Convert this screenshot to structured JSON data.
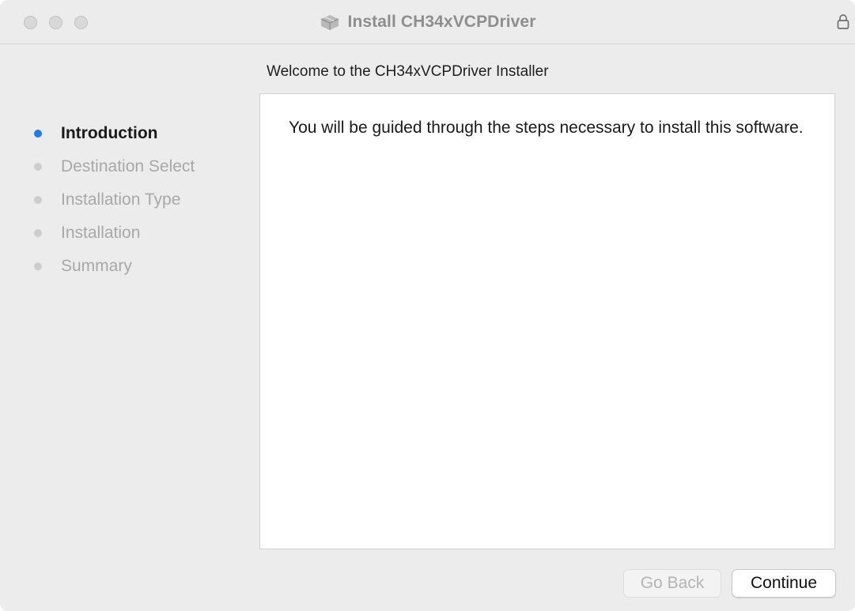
{
  "window": {
    "title": "Install CH34xVCPDriver",
    "title_icon": "package-installer-icon",
    "lock_icon": "lock-icon"
  },
  "header": {
    "welcome": "Welcome to the CH34xVCPDriver Installer"
  },
  "sidebar": {
    "active_color": "#1b7cf5",
    "inactive_color": "#cdcdcd",
    "steps": [
      {
        "label": "Introduction",
        "active": true
      },
      {
        "label": "Destination Select",
        "active": false
      },
      {
        "label": "Installation Type",
        "active": false
      },
      {
        "label": "Installation",
        "active": false
      },
      {
        "label": "Summary",
        "active": false
      }
    ]
  },
  "content": {
    "body": "You will be guided through the steps necessary to install this software."
  },
  "buttons": {
    "back_label": "Go Back",
    "back_enabled": false,
    "continue_label": "Continue"
  }
}
